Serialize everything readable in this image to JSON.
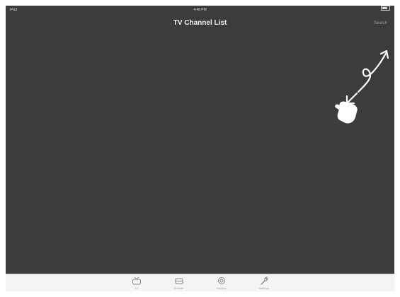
{
  "status_bar": {
    "carrier": "iPad",
    "time": "4:48 PM",
    "battery_icon": "battery-icon"
  },
  "nav": {
    "title": "TV Channel List",
    "action_label": "Search"
  },
  "gesture": {
    "hand_icon": "tap-hand-icon",
    "arrow_icon": "curved-arrow-icon"
  },
  "tab_bar": {
    "tabs": [
      {
        "label": "TV",
        "icon": "tv-icon"
      },
      {
        "label": "Remote",
        "icon": "remote-icon"
      },
      {
        "label": "Record",
        "icon": "record-icon"
      },
      {
        "label": "Settings",
        "icon": "wrench-icon"
      }
    ]
  },
  "colors": {
    "background": "#3c3c3c",
    "tab_bar": "#f4f4f4",
    "title": "#f2f2f2"
  }
}
